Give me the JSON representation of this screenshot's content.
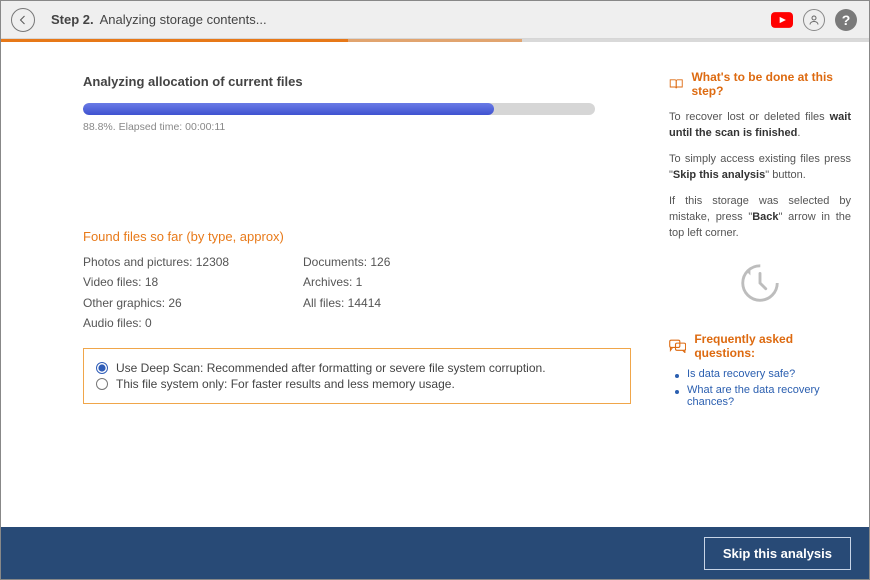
{
  "header": {
    "step_bold": "Step 2.",
    "step_text": "Analyzing storage contents..."
  },
  "progress": {
    "title": "Analyzing allocation of current files",
    "percent": 88.8,
    "caption": "88.8%. Elapsed time: 00:00:11"
  },
  "found": {
    "title": "Found files so far (by type, approx)",
    "col1": {
      "photos": "Photos and pictures: 12308",
      "video": "Video files: 18",
      "graphics": "Other graphics: 26",
      "audio": "Audio files: 0"
    },
    "col2": {
      "documents": "Documents: 126",
      "archives": "Archives: 1",
      "all": "All files: 14414"
    }
  },
  "options": {
    "deep": "Use Deep Scan: Recommended after formatting or severe file system corruption.",
    "fsonly": "This file system only: For faster results and less memory usage."
  },
  "sidebar": {
    "head": "What's to be done at this step?",
    "p1a": "To recover lost or deleted files ",
    "p1b": "wait until the scan is finished",
    "p1c": ".",
    "p2a": "To simply access existing files press \"",
    "p2b": "Skip this analysis",
    "p2c": "\" button.",
    "p3a": "If this storage was selected by mistake, press \"",
    "p3b": "Back",
    "p3c": "\" arrow in the top left corner.",
    "faq_head": "Frequently asked questions:",
    "faq": [
      "Is data recovery safe?",
      "What are the data recovery chances?"
    ]
  },
  "footer": {
    "skip": "Skip this analysis"
  }
}
